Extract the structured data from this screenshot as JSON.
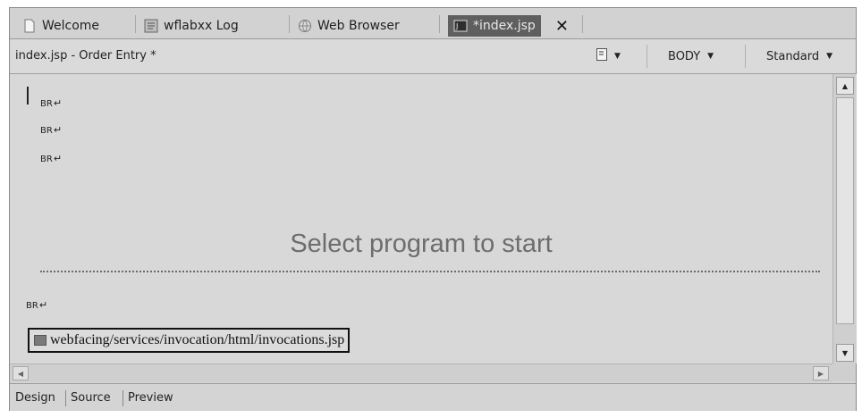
{
  "tabs": [
    {
      "label": "Welcome",
      "icon": "page-icon"
    },
    {
      "label": "wflabxx Log",
      "icon": "log-icon"
    },
    {
      "label": "Web Browser",
      "icon": "globe-icon"
    },
    {
      "label": "*index.jsp",
      "icon": "jsp-file-icon",
      "active": true
    }
  ],
  "close_glyph": "✕",
  "header": {
    "title": "index.jsp - Order Entry *",
    "tag_label": "BODY",
    "style_label": "Standard"
  },
  "canvas": {
    "br_marks": [
      "BR",
      "BR",
      "BR",
      "BR"
    ],
    "br_arrow": "↵",
    "heading": "Select program to start",
    "include_path": "webfacing/services/invocation/html/invocations.jsp"
  },
  "bottom_tabs": [
    "Design",
    "Source",
    "Preview"
  ],
  "colors": {
    "background": "#d6d6d6",
    "active_tab": "#5f5f5f",
    "heading_text": "#6d6d6d"
  }
}
